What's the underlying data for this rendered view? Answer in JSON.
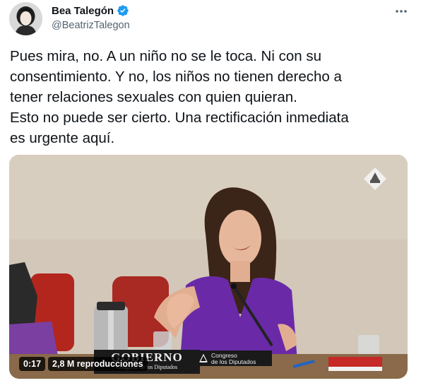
{
  "author": {
    "display_name": "Bea Talegón",
    "handle": "@BeatrizTalegon",
    "verified": true,
    "avatar_icon": "profile-photo"
  },
  "more_icon": "more-dots-icon",
  "tweet": {
    "lines": [
      "Pues mira, no. A un niño no se le toca. Ni con su",
      "consentimiento. Y no, los niños no tienen derecho a",
      "tener relaciones sexuales con quien quieran.",
      "Esto no puede ser cierto. Una rectificación inmediata",
      "es urgente aquí."
    ]
  },
  "video": {
    "time": "0:17",
    "views": "2,8 M reproducciones",
    "placard_left_big": "GOBIERNO",
    "placard_left_small": "Congreso de los Diputados",
    "placard_right_line1": "Congreso",
    "placard_right_line2": "de los Diputados"
  },
  "colors": {
    "verified": "#1d9bf0",
    "text": "#0f1419",
    "secondary": "#536471",
    "dress": "#6a2aa8"
  }
}
